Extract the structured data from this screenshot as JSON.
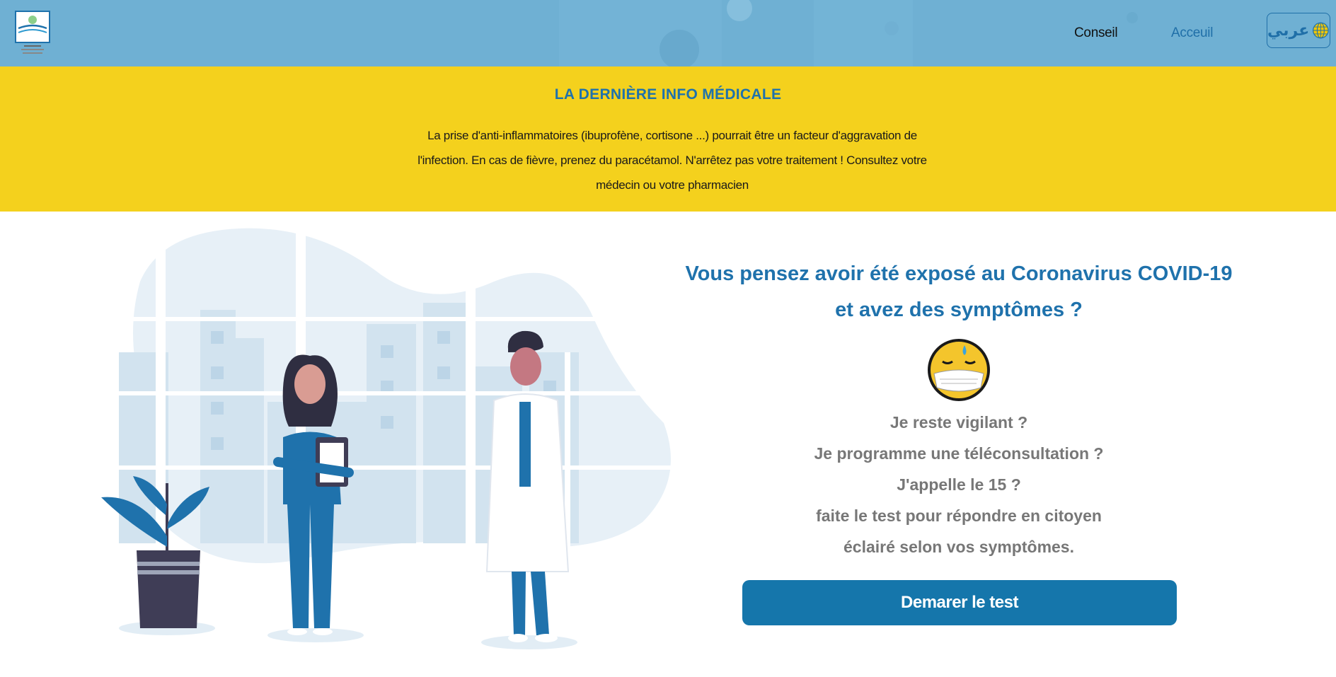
{
  "header": {
    "nav": {
      "conseil": "Conseil",
      "acceuil": "Acceuil"
    },
    "language_button": {
      "label": "عربي",
      "icon": "globe-icon"
    }
  },
  "banner": {
    "title": "LA DERNIÈRE INFO MÉDICALE",
    "text": "La prise d'anti-inflammatoires (ibuprofène, cortisone ...) pourrait être un facteur d'aggravation de l'infection. En cas de fièvre, prenez du paracétamol. N'arrêtez pas votre traitement ! Consultez votre médecin ou votre pharmacien"
  },
  "main": {
    "headline_line1": "Vous pensez avoir été exposé au Coronavirus COVID-19",
    "headline_line2": "et avez des symptômes ?",
    "emoji_icon": "sweating-face-with-mask-icon",
    "questions": [
      "Je reste vigilant ?",
      "Je programme une téléconsultation ?",
      "J'appelle le 15 ?",
      "faite le test pour répondre en citoyen",
      "éclairé selon vos symptômes."
    ],
    "start_button": "Demarer le test"
  },
  "colors": {
    "header_bg": "#6fb0d3",
    "banner_bg": "#f4d11d",
    "accent_blue": "#1f72ac",
    "button_bg": "#1576ab",
    "question_text": "#777777"
  }
}
